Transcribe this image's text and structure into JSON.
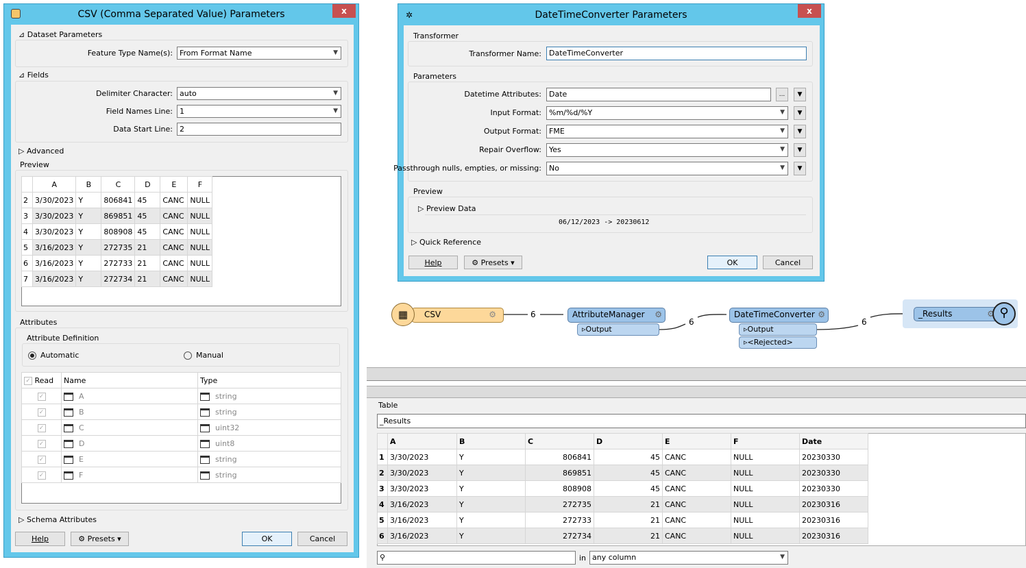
{
  "csv_dialog": {
    "title": "CSV (Comma Separated Value) Parameters",
    "close": "x",
    "dataset_section": "Dataset Parameters",
    "feature_type_label": "Feature Type Name(s):",
    "feature_type_value": "From Format Name",
    "fields_section": "Fields",
    "delimiter_label": "Delimiter Character:",
    "delimiter_value": "auto",
    "field_names_label": "Field Names Line:",
    "field_names_value": "1",
    "data_start_label": "Data Start Line:",
    "data_start_value": "2",
    "advanced_section": "Advanced",
    "preview_section": "Preview",
    "preview_columns": [
      "A",
      "B",
      "C",
      "D",
      "E",
      "F"
    ],
    "preview_rows": [
      {
        "n": "2",
        "cells": [
          "3/30/2023",
          "Y",
          "806841",
          "45",
          "CANC",
          "NULL"
        ]
      },
      {
        "n": "3",
        "cells": [
          "3/30/2023",
          "Y",
          "869851",
          "45",
          "CANC",
          "NULL"
        ]
      },
      {
        "n": "4",
        "cells": [
          "3/30/2023",
          "Y",
          "808908",
          "45",
          "CANC",
          "NULL"
        ]
      },
      {
        "n": "5",
        "cells": [
          "3/16/2023",
          "Y",
          "272735",
          "21",
          "CANC",
          "NULL"
        ]
      },
      {
        "n": "6",
        "cells": [
          "3/16/2023",
          "Y",
          "272733",
          "21",
          "CANC",
          "NULL"
        ]
      },
      {
        "n": "7",
        "cells": [
          "3/16/2023",
          "Y",
          "272734",
          "21",
          "CANC",
          "NULL"
        ]
      }
    ],
    "attributes_section": "Attributes",
    "attribute_definition": "Attribute Definition",
    "radio_automatic": "Automatic",
    "radio_manual": "Manual",
    "selected_mode": "Automatic",
    "attr_headers": {
      "read": "Read",
      "name": "Name",
      "type": "Type"
    },
    "attributes": [
      {
        "name": "A",
        "type": "string"
      },
      {
        "name": "B",
        "type": "string"
      },
      {
        "name": "C",
        "type": "uint32"
      },
      {
        "name": "D",
        "type": "uint8"
      },
      {
        "name": "E",
        "type": "string"
      },
      {
        "name": "F",
        "type": "string"
      }
    ],
    "schema_section": "Schema Attributes",
    "help": "Help",
    "presets": "Presets",
    "ok": "OK",
    "cancel": "Cancel"
  },
  "dtc_dialog": {
    "title": "DateTimeConverter Parameters",
    "close": "x",
    "transformer_section": "Transformer",
    "transformer_name_label": "Transformer Name:",
    "transformer_name_value": "DateTimeConverter",
    "parameters_section": "Parameters",
    "params": [
      {
        "label": "Datetime Attributes:",
        "value": "Date"
      },
      {
        "label": "Input Format:",
        "value": "%m/%d/%Y"
      },
      {
        "label": "Output Format:",
        "value": "FME"
      },
      {
        "label": "Repair Overflow:",
        "value": "Yes"
      },
      {
        "label": "Passthrough nulls, empties, or missing:",
        "value": "No"
      }
    ],
    "ellipsis": "...",
    "preview_section": "Preview",
    "preview_data": "Preview Data",
    "preview_text": "06/12/2023 -> 20230612",
    "quick_reference": "Quick Reference",
    "help": "Help",
    "presets": "Presets",
    "ok": "OK",
    "cancel": "Cancel"
  },
  "workflow": {
    "csv_node": "CSV",
    "attr_manager": "AttributeManager",
    "attr_output": "Output",
    "dtc_node": "DateTimeConverter",
    "dtc_output": "Output",
    "dtc_rejected": "<Rejected>",
    "results_node": "_Results",
    "counts": [
      "6",
      "6",
      "6"
    ],
    "colors": {
      "reader": "#fdd89a",
      "transformer": "#9cc3e8",
      "port": "#bcd6f0",
      "inspector_bg": "#d6e6f6"
    }
  },
  "results_table": {
    "section": "Table",
    "table_name": "_Results",
    "columns": [
      "A",
      "B",
      "C",
      "D",
      "E",
      "F",
      "Date"
    ],
    "rows": [
      {
        "n": "1",
        "cells": [
          "3/30/2023",
          "Y",
          "806841",
          "45",
          "CANC",
          "NULL",
          "20230330"
        ]
      },
      {
        "n": "2",
        "cells": [
          "3/30/2023",
          "Y",
          "869851",
          "45",
          "CANC",
          "NULL",
          "20230330"
        ]
      },
      {
        "n": "3",
        "cells": [
          "3/30/2023",
          "Y",
          "808908",
          "45",
          "CANC",
          "NULL",
          "20230330"
        ]
      },
      {
        "n": "4",
        "cells": [
          "3/16/2023",
          "Y",
          "272735",
          "21",
          "CANC",
          "NULL",
          "20230316"
        ]
      },
      {
        "n": "5",
        "cells": [
          "3/16/2023",
          "Y",
          "272733",
          "21",
          "CANC",
          "NULL",
          "20230316"
        ]
      },
      {
        "n": "6",
        "cells": [
          "3/16/2023",
          "Y",
          "272734",
          "21",
          "CANC",
          "NULL",
          "20230316"
        ]
      }
    ],
    "search_placeholder": "",
    "in_label": "in",
    "column_filter": "any column"
  }
}
